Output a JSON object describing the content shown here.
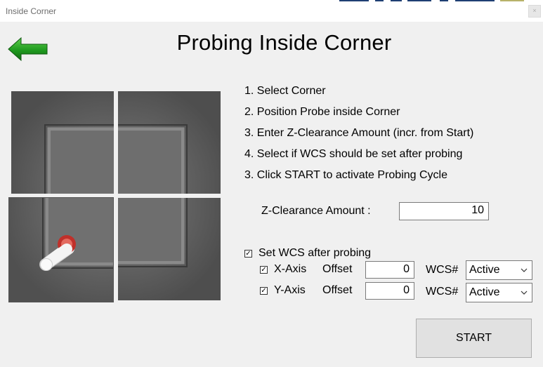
{
  "window": {
    "title": "Inside Corner"
  },
  "icons": {
    "back": "left-arrow-icon",
    "close": "close-icon"
  },
  "colors": {
    "arrow": "#1e8a1e",
    "probe_tip": "#c0302a"
  },
  "header": {
    "title": "Probing Inside Corner"
  },
  "steps": [
    "1. Select Corner",
    "2. Position Probe inside Corner",
    "3. Enter Z-Clearance Amount (incr. from Start)",
    "4. Select if WCS should be set after probing",
    "3. Click START to activate Probing Cycle"
  ],
  "z_clearance": {
    "label": "Z-Clearance Amount :",
    "value": "10"
  },
  "wcs": {
    "set_label": "Set WCS after probing",
    "set_checked": true,
    "x_axis": {
      "label": "X-Axis",
      "checked": true,
      "offset_label": "Offset",
      "offset_value": "0",
      "wcs_label": "WCS#",
      "wcs_value": "Active"
    },
    "y_axis": {
      "label": "Y-Axis",
      "checked": true,
      "offset_label": "Offset",
      "offset_value": "0",
      "wcs_label": "WCS#",
      "wcs_value": "Active"
    }
  },
  "corners": {
    "selected": "bottom-left"
  },
  "start_button": {
    "label": "START"
  }
}
